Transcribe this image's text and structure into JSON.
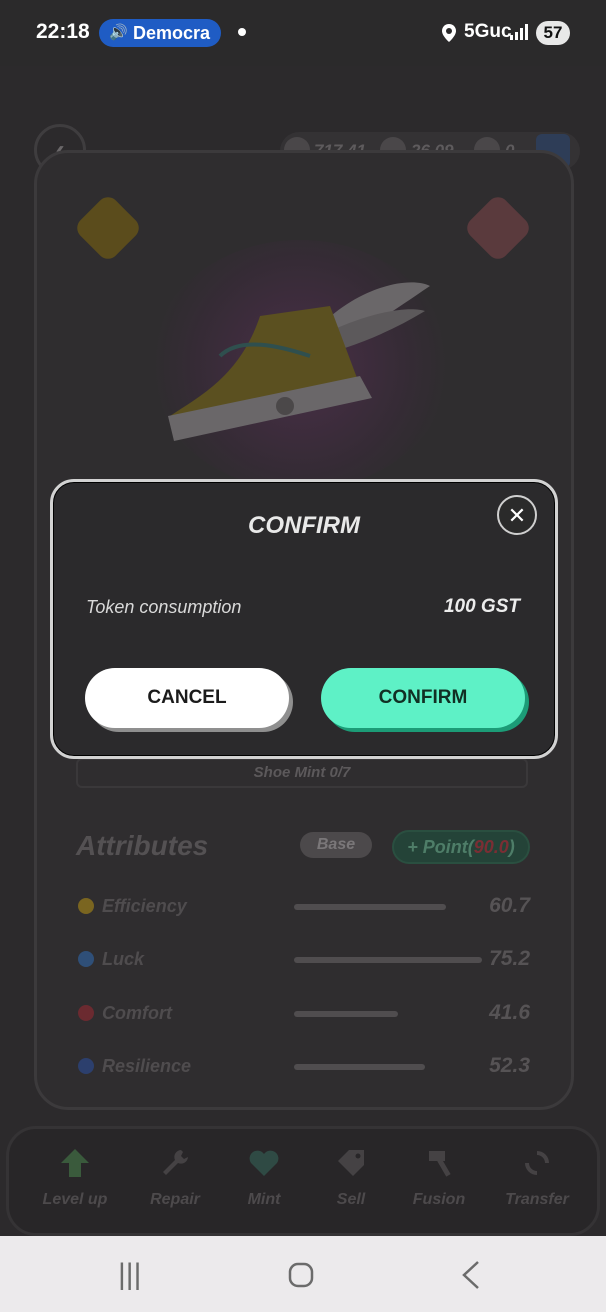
{
  "status_bar": {
    "time": "22:18",
    "media_label": "Democra",
    "network": "5Guc",
    "battery": "57"
  },
  "wallet": {
    "balance_1": "717.41",
    "balance_2": "26.09",
    "balance_3": "0"
  },
  "shoe": {
    "mint_label": "Shoe Mint 0/7"
  },
  "attributes": {
    "title": "Attributes",
    "base_label": "Base",
    "point_prefix": "+ Point(",
    "point_value": "90.0",
    "point_suffix": ")",
    "items": [
      {
        "name": "Efficiency",
        "value": "60.7",
        "fraction": 0.607,
        "color": "#7a6520"
      },
      {
        "name": "Luck",
        "value": "75.2",
        "fraction": 0.752,
        "color": "#2f4f78"
      },
      {
        "name": "Comfort",
        "value": "41.6",
        "fraction": 0.416,
        "color": "#6b2a30"
      },
      {
        "name": "Resilience",
        "value": "52.3",
        "fraction": 0.523,
        "color": "#2c3f6d"
      }
    ]
  },
  "bottom_nav": [
    "Level up",
    "Repair",
    "Mint",
    "Sell",
    "Fusion",
    "Transfer"
  ],
  "modal": {
    "title": "CONFIRM",
    "row_label": "Token consumption",
    "row_value": "100 GST",
    "cancel_label": "CANCEL",
    "confirm_label": "CONFIRM"
  },
  "colors": {
    "accent": "#5ef1c6",
    "background": "#2c2a2c"
  }
}
